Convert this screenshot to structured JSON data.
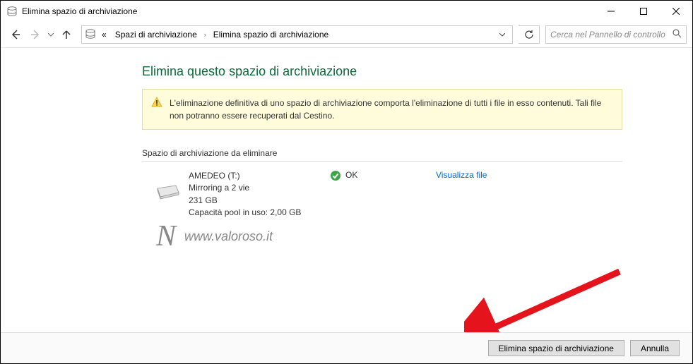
{
  "titlebar": {
    "title": "Elimina spazio di archiviazione"
  },
  "nav": {
    "breadcrumb_prefix": "«",
    "breadcrumb1": "Spazi di archiviazione",
    "breadcrumb2": "Elimina spazio di archiviazione",
    "search_placeholder": "Cerca nel Pannello di controllo"
  },
  "page": {
    "title": "Elimina questo spazio di archiviazione",
    "warning": "L'eliminazione definitiva di uno spazio di archiviazione comporta l'eliminazione di tutti i file in esso contenuti. Tali file non potranno essere recuperati dal Cestino.",
    "section_label": "Spazio di archiviazione da eliminare"
  },
  "space": {
    "name": "AMEDEO (T:)",
    "mode": "Mirroring a 2 vie",
    "size": "231 GB",
    "pool": "Capacità pool in uso: 2,00 GB",
    "status": "OK",
    "link": "Visualizza file"
  },
  "watermark": {
    "url": "www.valoroso.it"
  },
  "footer": {
    "confirm": "Elimina spazio di archiviazione",
    "cancel": "Annulla"
  }
}
